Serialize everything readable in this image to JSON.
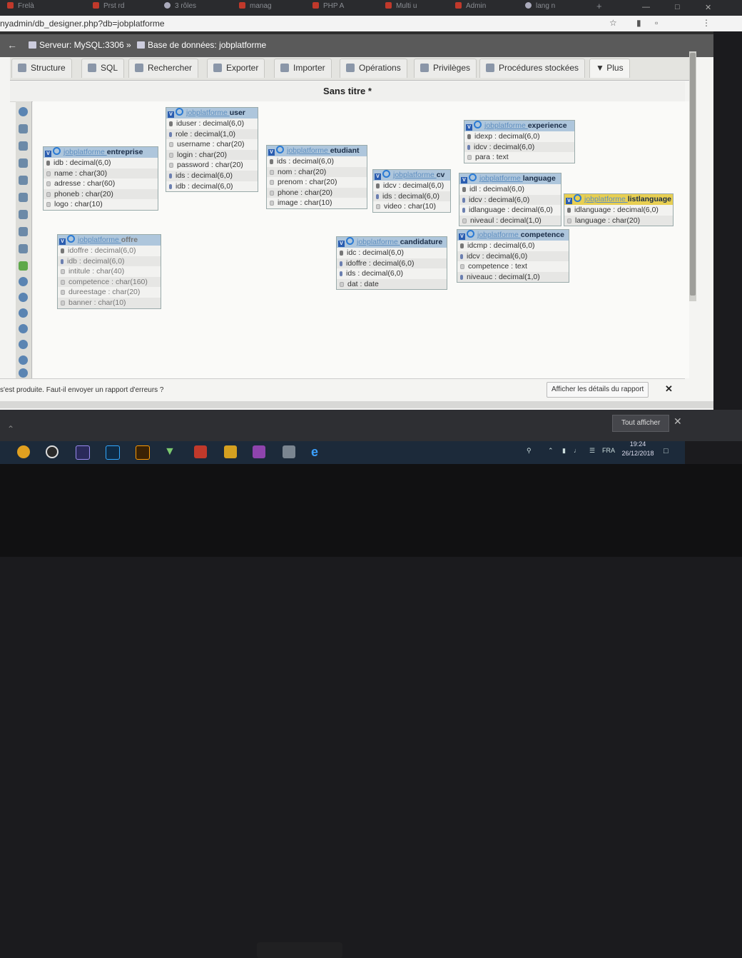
{
  "browser": {
    "tabs": [
      "Frelà",
      "Prst rd",
      "3 rôles",
      "manag",
      "PHP A",
      "Multi u",
      "Admin",
      "lang n"
    ],
    "new_tab": "+",
    "url": "nyadmin/db_designer.php?db=jobplatforme",
    "window_controls": [
      "—",
      "□",
      "✕"
    ]
  },
  "breadcrumb": {
    "server": "Serveur: MySQL:3306 »",
    "database": "Base de données: jobplatforme"
  },
  "tabs": [
    {
      "label": "Structure",
      "icon": "structure-icon"
    },
    {
      "label": "SQL",
      "icon": "sql-icon"
    },
    {
      "label": "Rechercher",
      "icon": "search-icon"
    },
    {
      "label": "Exporter",
      "icon": "export-icon"
    },
    {
      "label": "Importer",
      "icon": "import-icon"
    },
    {
      "label": "Opérations",
      "icon": "wrench-icon"
    },
    {
      "label": "Privilèges",
      "icon": "privileges-icon"
    },
    {
      "label": "Procédures stockées",
      "icon": "routines-icon"
    },
    {
      "label": "Plus",
      "icon": "caret-down-icon"
    }
  ],
  "designer": {
    "title": "Sans titre *"
  },
  "tables": [
    {
      "db": "jobplatforme",
      "name": "user",
      "rows": [
        "iduser : decimal(6,0)",
        "role : decimal(1,0)",
        "username : char(20)",
        "login : char(20)",
        "password : char(20)",
        "ids : decimal(6,0)",
        "idb : decimal(6,0)"
      ]
    },
    {
      "db": "jobplatforme",
      "name": "entreprise",
      "rows": [
        "idb : decimal(6,0)",
        "name : char(30)",
        "adresse : char(60)",
        "phoneb : char(20)",
        "logo : char(10)"
      ]
    },
    {
      "db": "jobplatforme",
      "name": "etudiant",
      "rows": [
        "ids : decimal(6,0)",
        "nom : char(20)",
        "prenom : char(20)",
        "phone : char(20)",
        "image : char(10)"
      ]
    },
    {
      "db": "jobplatforme",
      "name": "cv",
      "rows": [
        "idcv : decimal(6,0)",
        "ids : decimal(6,0)",
        "video : char(10)"
      ]
    },
    {
      "db": "jobplatforme",
      "name": "experience",
      "rows": [
        "idexp : decimal(6,0)",
        "idcv : decimal(6,0)",
        "para : text"
      ]
    },
    {
      "db": "jobplatforme",
      "name": "language",
      "rows": [
        "idl : decimal(6,0)",
        "idcv : decimal(6,0)",
        "idlanguage : decimal(6,0)",
        "niveaul : decimal(1,0)"
      ]
    },
    {
      "db": "jobplatforme",
      "name": "listlanguage",
      "rows": [
        "idlanguage : decimal(6,0)",
        "language : char(20)"
      ]
    },
    {
      "db": "jobplatforme",
      "name": "offre",
      "rows": [
        "idoffre : decimal(6,0)",
        "idb : decimal(6,0)",
        "intitule : char(40)",
        "competence : char(160)",
        "dureestage : char(20)",
        "banner : char(10)"
      ]
    },
    {
      "db": "jobplatforme",
      "name": "candidature",
      "rows": [
        "idc : decimal(6,0)",
        "idoffre : decimal(6,0)",
        "ids : decimal(6,0)",
        "dat : date"
      ]
    },
    {
      "db": "jobplatforme",
      "name": "competence",
      "rows": [
        "idcmp : decimal(6,0)",
        "idcv : decimal(6,0)",
        "competence : text",
        "niveauc : decimal(1,0)"
      ]
    }
  ],
  "error": {
    "message": "s'est produite. Faut-il envoyer un rapport d'erreurs ?",
    "details_button": "Afficher les détails du rapport",
    "close": "✕"
  },
  "downloads": {
    "show_all": "Tout afficher",
    "close": "✕"
  },
  "taskbar": {
    "language": "FRA",
    "time": "19:24",
    "date": "26/12/2018",
    "apps": [
      "chrome",
      "obs",
      "premiere",
      "photoshop",
      "illustrator",
      "vectorworks",
      "filezilla",
      "sublime",
      "phpstorm",
      "calculator",
      "edge"
    ]
  },
  "accent_colors": {
    "table_header": "#aec6dc",
    "selected_header": "#e8cf52",
    "pma_bar": "#5a5a5a"
  }
}
